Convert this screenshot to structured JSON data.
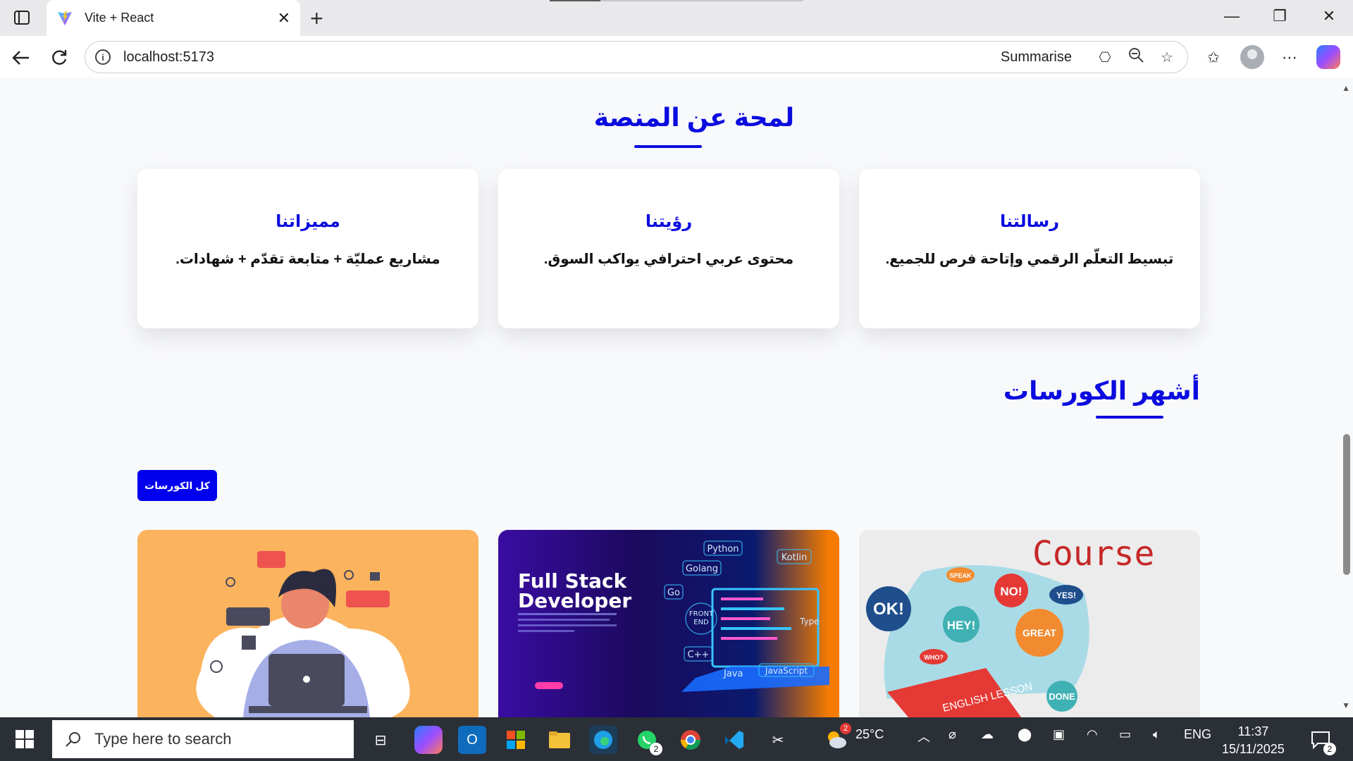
{
  "browser": {
    "tab_title": "Vite + React",
    "tab_close": "✕",
    "new_tab": "+",
    "url": "localhost:5173",
    "summarise_label": "Summarise",
    "window_controls": {
      "minimize": "—",
      "restore": "❐",
      "close": "✕"
    }
  },
  "page": {
    "about": {
      "title": "لمحة عن المنصة",
      "cards": [
        {
          "heading": "رسالتنا",
          "text": "تبسيط التعلّم الرقمي وإتاحة فرص للجميع."
        },
        {
          "heading": "رؤيتنا",
          "text": "محتوى عربي احترافي يواكب السوق."
        },
        {
          "heading": "مميزاتنا",
          "text": "مشاريع عمليّة + متابعة تقدّم + شهادات."
        }
      ]
    },
    "courses": {
      "title": "أشهر الكورسات",
      "all_button": "كل الكورسات",
      "items": [
        {
          "image_text": "Course",
          "bubbles": [
            "OK!",
            "NO!",
            "HEY!",
            "YES!",
            "GREAT",
            "DONE",
            "SPEAK",
            "WHO?"
          ],
          "book_text": "ENGLISH LESSON"
        },
        {
          "image_title_line1": "Full Stack",
          "image_title_line2": "Developer",
          "tags": [
            "Python",
            "Kotlin",
            "Golang",
            "Go",
            "FRONT END",
            "C++",
            "Java",
            "JavaScript",
            "Type"
          ]
        },
        {
          "image_text": ""
        }
      ]
    }
  },
  "taskbar": {
    "search_placeholder": "Type here to search",
    "weather": "25°C",
    "language": "ENG",
    "time": "11:37",
    "date": "15/11/2025",
    "whatsapp_badge": "2",
    "weather_badge": "2",
    "notif_badge": "2"
  }
}
